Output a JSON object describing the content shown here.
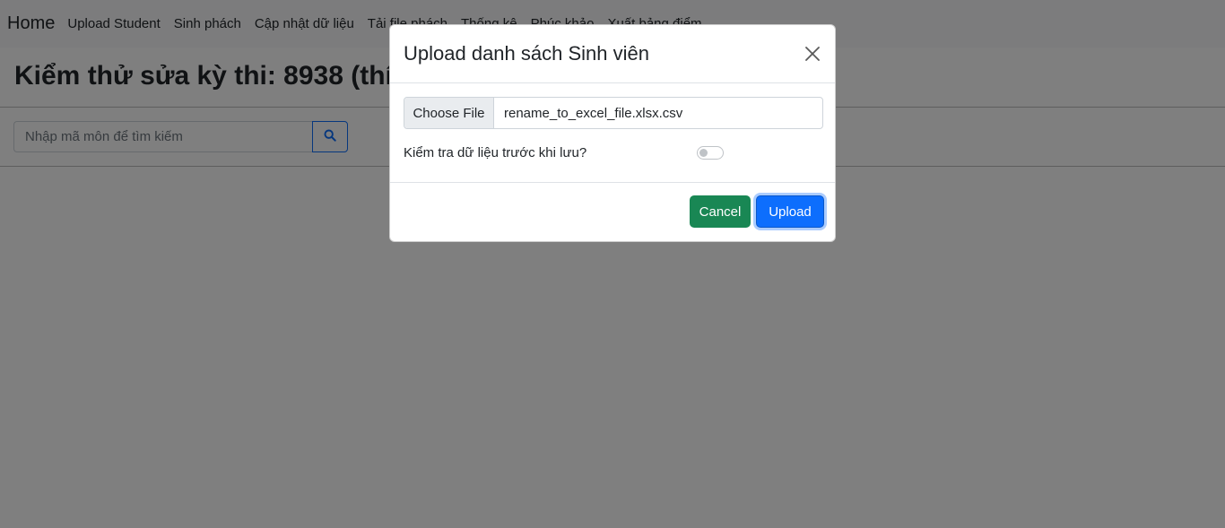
{
  "navbar": {
    "brand": "Home",
    "links": [
      "Upload Student",
      "Sinh phách",
      "Cập nhật dữ liệu",
      "Tải file phách",
      "Thống kê",
      "Phúc khảo",
      "Xuất bảng điểm"
    ]
  },
  "page": {
    "title": "Kiểm thử sửa kỳ thi: 8938 (thí s",
    "search": {
      "placeholder": "Nhập mã môn để tìm kiếm",
      "icon": "search-icon"
    }
  },
  "modal": {
    "title": "Upload danh sách Sinh viên",
    "file_button": "Choose File",
    "file_name": "rename_to_excel_file.xlsx.csv",
    "check_label": "Kiểm tra dữ liệu trước khi lưu?",
    "check_on": false,
    "cancel_label": "Cancel",
    "upload_label": "Upload"
  },
  "colors": {
    "primary": "#0d6efd",
    "success": "#198754"
  }
}
